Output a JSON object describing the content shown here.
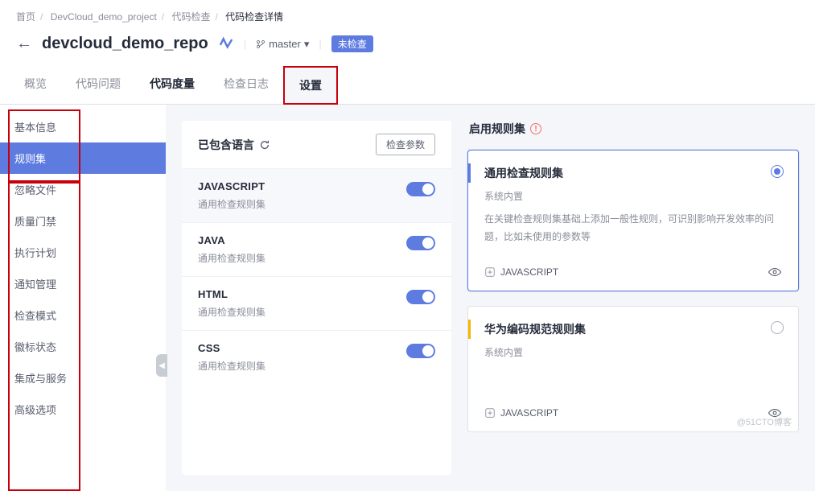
{
  "breadcrumb": {
    "home": "首页",
    "project": "DevCloud_demo_project",
    "inspect": "代码检查",
    "detail": "代码检查详情"
  },
  "header": {
    "repo": "devcloud_demo_repo",
    "branch": "master",
    "badge": "未检查"
  },
  "tabs": {
    "overview": "概览",
    "issues": "代码问题",
    "metrics": "代码度量",
    "logs": "检查日志",
    "settings": "设置"
  },
  "sidebar": {
    "items": [
      {
        "label": "基本信息"
      },
      {
        "label": "规则集"
      },
      {
        "label": "忽略文件"
      },
      {
        "label": "质量门禁"
      },
      {
        "label": "执行计划"
      },
      {
        "label": "通知管理"
      },
      {
        "label": "检查模式"
      },
      {
        "label": "徽标状态"
      },
      {
        "label": "集成与服务"
      },
      {
        "label": "高级选项"
      }
    ]
  },
  "left": {
    "title": "已包含语言",
    "button": "检查参数",
    "langs": [
      {
        "name": "JAVASCRIPT",
        "sub": "通用检查规则集"
      },
      {
        "name": "JAVA",
        "sub": "通用检查规则集"
      },
      {
        "name": "HTML",
        "sub": "通用检查规则集"
      },
      {
        "name": "CSS",
        "sub": "通用检查规则集"
      }
    ]
  },
  "right": {
    "title": "启用规则集",
    "cards": [
      {
        "title": "通用检查规则集",
        "meta": "系统内置",
        "desc": "在关键检查规则集基础上添加一般性规则，可识别影响开发效率的问题，比如未使用的参数等",
        "lang": "JAVASCRIPT"
      },
      {
        "title": "华为编码规范规则集",
        "meta": "系统内置",
        "desc": "",
        "lang": "JAVASCRIPT"
      }
    ]
  },
  "watermark": "@51CTO博客"
}
